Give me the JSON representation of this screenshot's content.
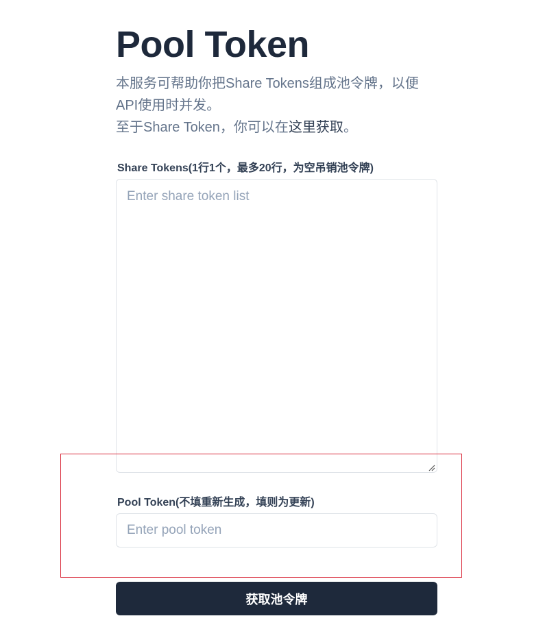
{
  "header": {
    "title": "Pool Token",
    "description_line1": "本服务可帮助你把Share Tokens组成池令牌，以便API使用时并发。",
    "description_line3_prefix": "至于Share Token，你可以在",
    "description_link": "这里获取",
    "description_line3_suffix": "。"
  },
  "form": {
    "share_tokens": {
      "label": "Share Tokens(1行1个，最多20行，为空吊销池令牌)",
      "placeholder": "Enter share token list",
      "value": ""
    },
    "pool_token": {
      "label": "Pool Token(不填重新生成，填则为更新)",
      "placeholder": "Enter pool token",
      "value": ""
    },
    "submit_label": "获取池令牌"
  },
  "colors": {
    "title": "#1e293b",
    "description": "#64748b",
    "button_bg": "#1e293b",
    "highlight_border": "#d92a3a"
  }
}
